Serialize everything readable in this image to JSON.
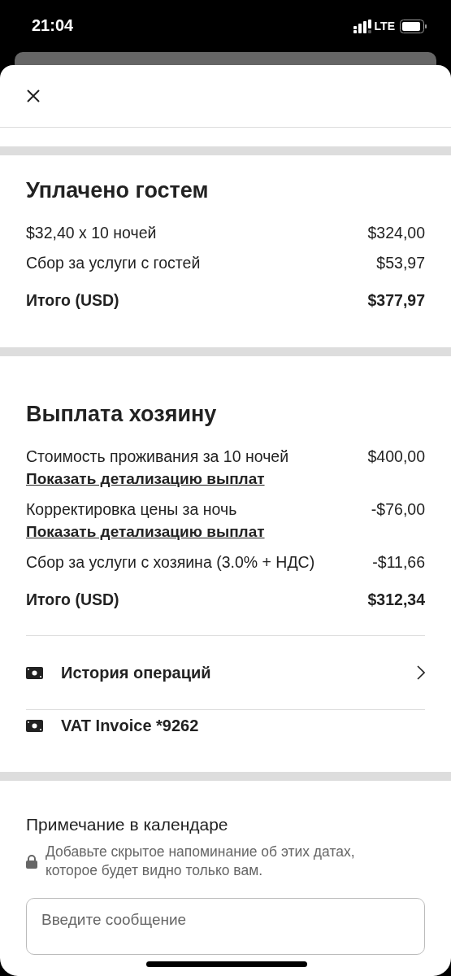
{
  "status_bar": {
    "time": "21:04",
    "network": "LTE"
  },
  "sections": [
    {
      "title": "Уплачено гостем",
      "items": [
        {
          "kind": "line",
          "label": "$32,40 x 10 ночей",
          "amount": "$324,00"
        },
        {
          "kind": "line",
          "label": "Сбор за услуги с гостей",
          "amount": "$53,97"
        },
        {
          "kind": "total",
          "label": "Итого (USD)",
          "amount": "$377,97"
        }
      ]
    },
    {
      "title": "Выплата хозяину",
      "items": [
        {
          "kind": "line",
          "label": "Стоимость проживания за 10 ночей",
          "amount": "$400,00",
          "link": "Показать детализацию выплат"
        },
        {
          "kind": "line",
          "label": "Корректировка цены за ночь",
          "amount": "-$76,00",
          "link": "Показать детализацию выплат"
        },
        {
          "kind": "line",
          "label": "Сбор за услуги с хозяина (3.0% + НДС)",
          "amount": "-$11,66"
        },
        {
          "kind": "total",
          "label": "Итого (USD)",
          "amount": "$312,34"
        }
      ],
      "links": [
        {
          "label": "История операций",
          "chevron": true
        },
        {
          "label": "VAT Invoice *9262",
          "chevron": false
        }
      ]
    }
  ],
  "note": {
    "title": "Примечание в календаре",
    "hint": "Добавьте скрытое напоминание об этих датах, которое будет видно только вам.",
    "placeholder": "Введите сообщение"
  }
}
